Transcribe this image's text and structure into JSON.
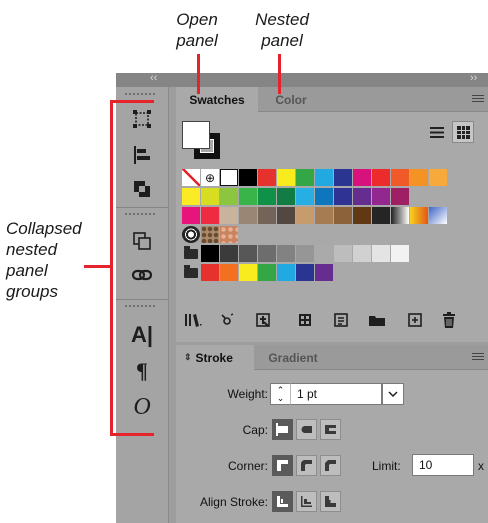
{
  "callouts": {
    "open_panel": [
      "Open",
      "panel"
    ],
    "nested_panel": [
      "Nested",
      "panel"
    ],
    "collapsed": [
      "Collapsed",
      "nested",
      "panel",
      "groups"
    ]
  },
  "topbar": {
    "collapse_left": "‹‹",
    "collapse_right": "››"
  },
  "panel_swatches": {
    "tabs": [
      "Swatches",
      "Color"
    ],
    "active_tab": "Swatches",
    "swatch_rows": [
      [
        "none",
        "registration",
        "white",
        "black",
        "#e5322d",
        "#f8ec1e",
        "#33a645",
        "#23a9e1",
        "#2a3491",
        "#d8127d",
        "#ec2b2d",
        "#f05a28",
        "#f39325",
        "#f7aa3b"
      ],
      [
        "#faeb24",
        "#d7de21",
        "#8cc641",
        "#38b449",
        "#0f9247",
        "#117c43",
        "#27aee3",
        "#0e76bc",
        "#2f3393",
        "#662d91",
        "#92278f",
        "#9e1f63"
      ],
      [
        "#e7157b",
        "#ee2b41",
        "#c8b39c",
        "#998675",
        "#736358",
        "#534741",
        "#c69c6d",
        "#a67c52",
        "#8b6239",
        "#603813",
        "#252525",
        "gradient-bw",
        "gradient-orange",
        "gradient-blue"
      ],
      [
        "pattern-a",
        "pattern-b",
        "pattern-c"
      ],
      [
        "folder",
        "#000000",
        "#3b3b3b",
        "#575757",
        "#6d6d6d",
        "#828282",
        "#969696",
        "#aaaaaa",
        "#bdbdbd",
        "#d1d1d1",
        "#e4e4e4",
        "#f2f2f2"
      ],
      [
        "folder",
        "#e5322d",
        "#f37021",
        "#f8ec1e",
        "#33a645",
        "#23a9e1",
        "#2a3491",
        "#662d91"
      ]
    ],
    "bottom_icons": [
      "swatch-libraries-icon",
      "show-kinds-icon",
      "swatch-options-icon",
      "color-group-icon",
      "edit-group-icon",
      "new-group-icon",
      "new-swatch-icon",
      "delete-icon"
    ]
  },
  "panel_stroke": {
    "tabs": [
      "Stroke",
      "Gradient"
    ],
    "weight_label": "Weight:",
    "weight_value": "1 pt",
    "cap_label": "Cap:",
    "corner_label": "Corner:",
    "limit_label": "Limit:",
    "limit_value": "10",
    "limit_unit": "x",
    "align_label": "Align Stroke:"
  },
  "accent_color": "#e4232b"
}
